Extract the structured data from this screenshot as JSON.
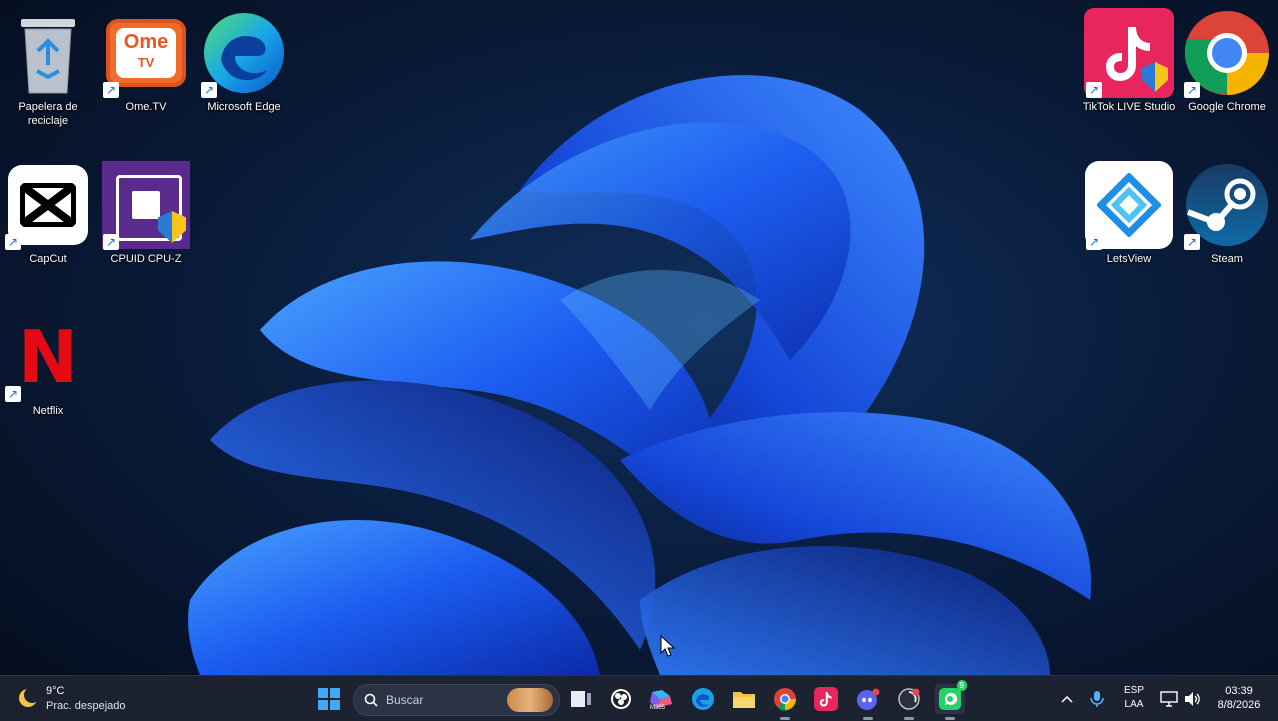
{
  "desktop": {
    "icons": [
      {
        "label_line1": "Papelera de",
        "label_line2": "reciclaje"
      },
      {
        "label": "Ome.TV"
      },
      {
        "label": "Microsoft Edge"
      },
      {
        "label": "CapCut"
      },
      {
        "label": "CPUID CPU-Z"
      },
      {
        "label": "Netflix"
      },
      {
        "label": "TikTok LIVE Studio"
      },
      {
        "label": "Google Chrome"
      },
      {
        "label": "LetsView"
      },
      {
        "label": "Steam"
      }
    ],
    "art_text": {
      "ome_top": "Ome",
      "ome_bottom": "TV",
      "netflix": "N"
    }
  },
  "taskbar": {
    "weather": {
      "temp": "9°C",
      "condition": "Prac. despejado"
    },
    "search": {
      "placeholder": "Buscar"
    },
    "m365_label": "M365",
    "tray": {
      "lang_line1": "ESP",
      "lang_line2": "LAA",
      "time": "03:39",
      "date": "8/8/2026"
    },
    "badges": {
      "whatsapp": "9"
    }
  },
  "colors": {
    "accent": "#2b6cff",
    "taskbar_bg": "#1c2230",
    "netflix_red": "#e50914",
    "tiktok_pink": "#e6265c",
    "ome_orange": "#f26b2a"
  }
}
